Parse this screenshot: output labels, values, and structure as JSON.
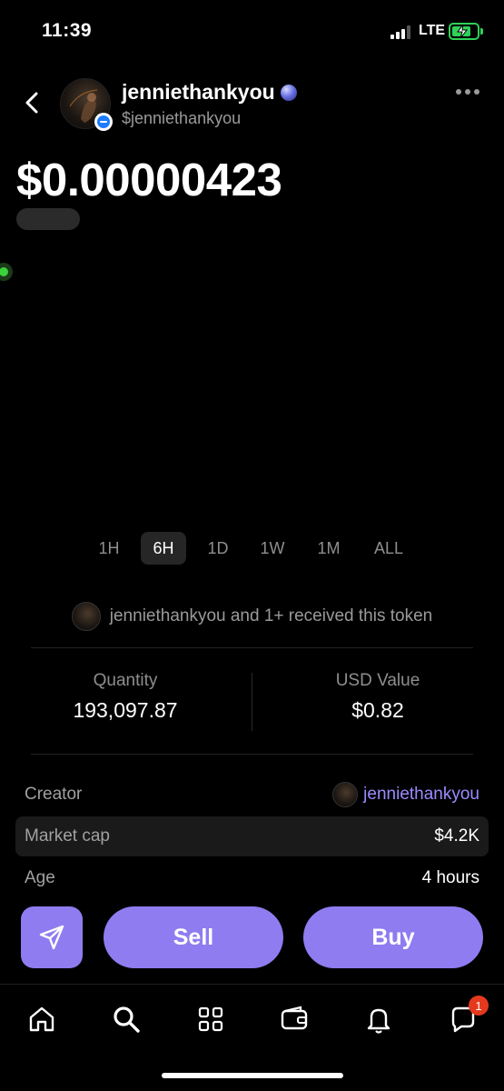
{
  "status_bar": {
    "time": "11:39",
    "network": "LTE"
  },
  "profile": {
    "display_name": "jenniethankyou",
    "handle": "$jenniethankyou"
  },
  "token": {
    "price": "$0.00000423"
  },
  "timeframes": {
    "options": [
      "1H",
      "6H",
      "1D",
      "1W",
      "1M",
      "ALL"
    ],
    "selected": "6H"
  },
  "received_text": "jenniethankyou and 1+ received this token",
  "stats": {
    "quantity_label": "Quantity",
    "quantity_value": "193,097.87",
    "usd_label": "USD Value",
    "usd_value": "$0.82"
  },
  "details": {
    "creator_label": "Creator",
    "creator_value": "jenniethankyou",
    "market_cap_label": "Market cap",
    "market_cap_value": "$4.2K",
    "age_label": "Age",
    "age_value": "4 hours"
  },
  "actions": {
    "sell_label": "Sell",
    "buy_label": "Buy"
  },
  "tab_bar": {
    "icons": [
      "home-icon",
      "search-icon",
      "grid-icon",
      "wallet-icon",
      "bell-icon",
      "chat-icon"
    ],
    "chat_badge_count": "1"
  },
  "colors": {
    "accent": "#8f7cf0",
    "link": "#9b8bff",
    "badge": "#e5391e",
    "battery": "#30d158"
  }
}
